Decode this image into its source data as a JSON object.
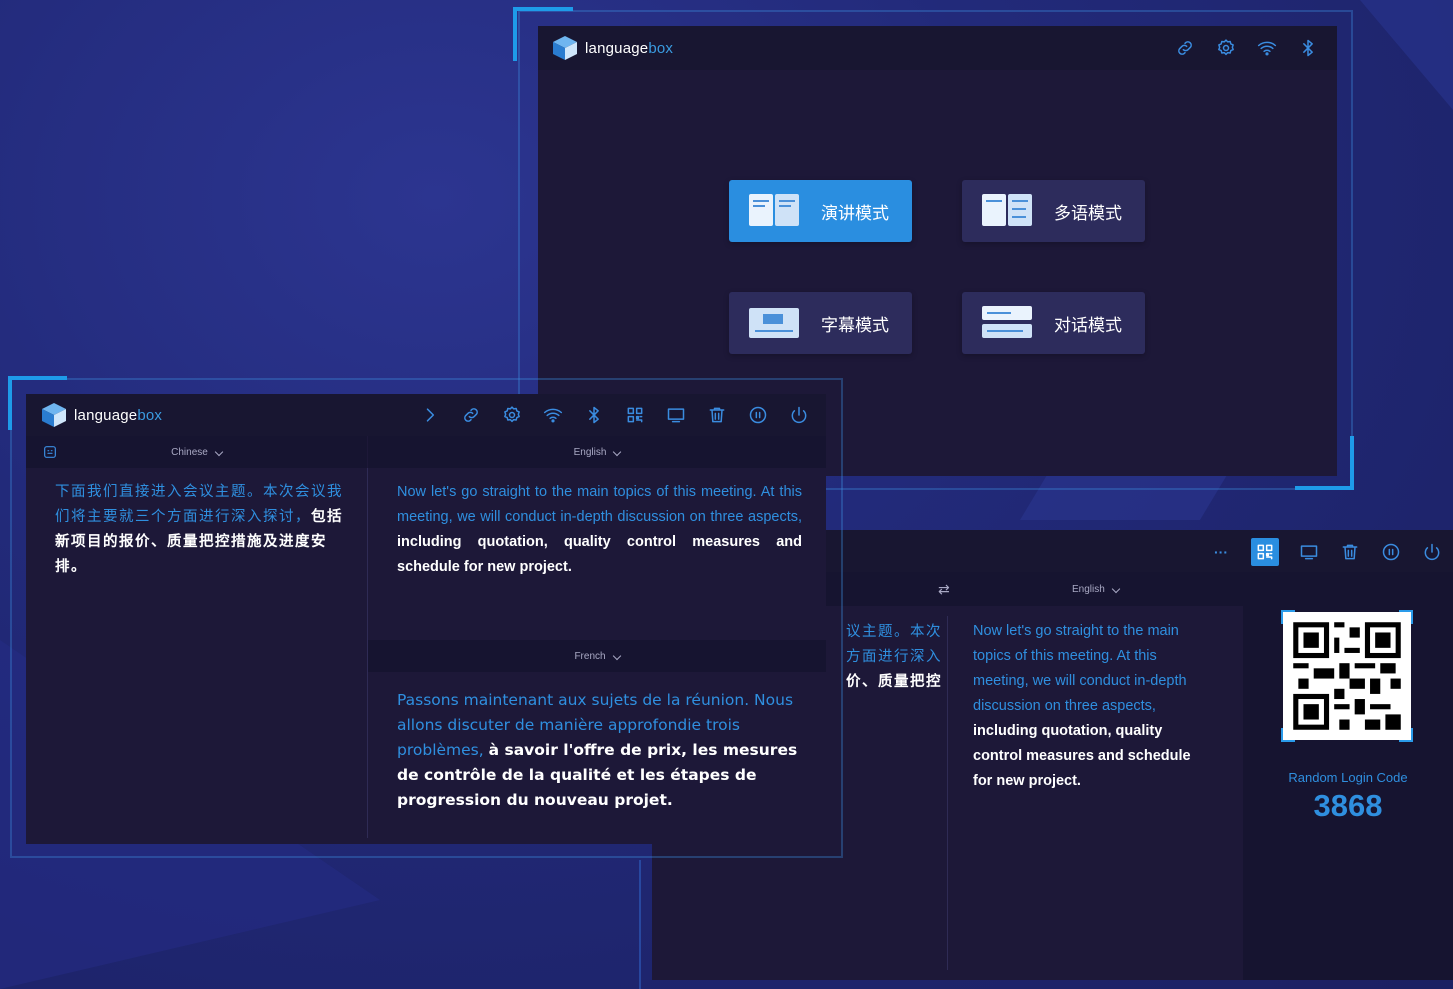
{
  "colors": {
    "accent": "#2f8fdf",
    "window_bg": "#1d1838",
    "header_bg": "#181631",
    "page_bg": "#222a7a"
  },
  "main_window": {
    "logo": {
      "part1": "language",
      "part2": "box"
    },
    "icons": [
      "link-icon",
      "gear-icon",
      "wifi-icon",
      "bluetooth-icon"
    ],
    "modes": [
      {
        "label": "演讲模式",
        "active": true
      },
      {
        "label": "多语模式",
        "active": false
      },
      {
        "label": "字幕模式",
        "active": false
      },
      {
        "label": "对话模式",
        "active": false
      }
    ]
  },
  "translate_window": {
    "logo": {
      "part1": "language",
      "part2": "box"
    },
    "icons": [
      "chevron-right-icon",
      "link-icon",
      "gear-icon",
      "wifi-icon",
      "bluetooth-icon",
      "qr-code-icon",
      "monitor-icon",
      "trash-icon",
      "pause-icon",
      "power-icon"
    ],
    "source_lang": "Chinese",
    "target_lang_1": "English",
    "target_lang_2": "French",
    "source_text_blue": "下面我们直接进入会议主题。本次会议我们将主要就三个方面进行深入探讨，",
    "source_text_white": "包括新项目的报价、质量把控措施及进度安排。",
    "en_text_blue": "Now let's go straight to the main topics of this meeting. At this meeting, we will conduct in-depth discussion on three aspects,",
    "en_text_white": "including quotation, quality control measures and schedule for new project.",
    "fr_text_blue": "Passons maintenant aux sujets de la réunion. Nous allons discuter de manière approfondie trois problèmes,",
    "fr_text_white": "à savoir l'offre de prix, les mesures de contrôle de la qualité et les étapes de progression du nouveau projet."
  },
  "right_window": {
    "more_label": "···",
    "icons": [
      "qr-code-icon",
      "monitor-icon",
      "trash-icon",
      "pause-icon",
      "power-icon"
    ],
    "swap_label": "⇄",
    "target_lang": "English",
    "partial_source_lines": [
      "议主题。本次",
      "方面进行深入",
      "价、质量把控"
    ],
    "en_text_blue": "Now let's go straight to the main topics of this meeting. At this meeting, we will conduct in-depth discussion on three aspects,",
    "en_text_white": "including quotation, quality control measures and schedule for new project.",
    "login_code_label": "Random Login Code",
    "login_code": "3868"
  }
}
